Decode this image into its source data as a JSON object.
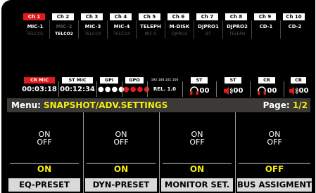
{
  "channels": [
    {
      "num": "Ch 1",
      "name": "MIC-1",
      "sub": "TELCO1",
      "active": true,
      "name_dim": false,
      "sub_bright": false
    },
    {
      "num": "Ch 2",
      "name": "MIC-2",
      "sub": "TELCO2",
      "active": false,
      "name_dim": true,
      "sub_bright": true
    },
    {
      "num": "Ch 3",
      "name": "MIC-3",
      "sub": "TELCO3",
      "active": false,
      "name_dim": false,
      "sub_bright": false
    },
    {
      "num": "Ch 4",
      "name": "MIC-4",
      "sub": "TELCO4",
      "active": false,
      "name_dim": false,
      "sub_bright": false
    },
    {
      "num": "Ch 5",
      "name": "TELEPH",
      "sub": "MIC-5",
      "active": false,
      "name_dim": false,
      "sub_bright": false
    },
    {
      "num": "Ch 6",
      "name": "M-DISK",
      "sub": "DJPRO2",
      "active": false,
      "name_dim": false,
      "sub_bright": false
    },
    {
      "num": "Ch 7",
      "name": "DJPRO1",
      "sub": "BT",
      "active": false,
      "name_dim": false,
      "sub_bright": false
    },
    {
      "num": "Ch 8",
      "name": "DJPRO2",
      "sub": "TELEPH",
      "active": false,
      "name_dim": false,
      "sub_bright": false
    },
    {
      "num": "Ch 9",
      "name": "CD-1",
      "sub": "",
      "active": false,
      "name_dim": false,
      "sub_bright": false
    },
    {
      "num": "Ch 10",
      "name": "CD-2",
      "sub": "",
      "active": false,
      "name_dim": false,
      "sub_bright": false
    }
  ],
  "status": {
    "cr_mic": {
      "label": "CR MIC",
      "value": "00:03:18"
    },
    "st_mic": {
      "label": "ST MIC",
      "value": "00:12:34"
    },
    "gpi": {
      "label": "GPI",
      "value": "●●●●"
    },
    "gpo": {
      "label": "GPO",
      "value": "●●●●"
    },
    "ip": "192.168.101.100",
    "release": "REL. 1.0",
    "monitors": [
      {
        "label": "ST",
        "icon": "headphones-icon",
        "value": "00"
      },
      {
        "label": "ST",
        "icon": "speaker-icon",
        "value": "00"
      },
      {
        "label": "CR",
        "icon": "headphones-icon",
        "value": "00"
      },
      {
        "label": "CR",
        "icon": "speaker-icon",
        "value": "00"
      }
    ]
  },
  "menu": {
    "label": "Menu:",
    "path": "SNAPSHOT/ADV.SETTINGS",
    "page_prefix": "Page:",
    "page": "1/2"
  },
  "columns": [
    {
      "on": "ON",
      "off": "OFF",
      "value": "ON",
      "name": "EQ-PRESET"
    },
    {
      "on": "ON",
      "off": "OFF",
      "value": "ON",
      "name": "DYN-PRESET"
    },
    {
      "on": "ON",
      "off": "OFF",
      "value": "ON",
      "name": "MONITOR SET."
    },
    {
      "on": "ON",
      "off": "OFF",
      "value": "OFF",
      "name": "BUS ASSIGMENT"
    }
  ],
  "colors": {
    "accent_yellow": "#f7ee10",
    "alert_red": "#e31b1b",
    "menu_bar": "#3b3a37",
    "tab_gray": "#d9d9d9"
  }
}
